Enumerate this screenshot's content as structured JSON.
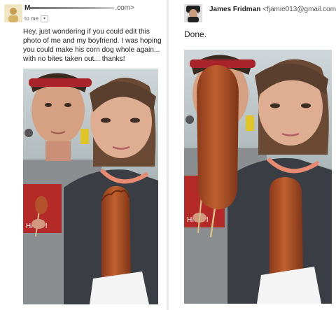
{
  "left_email": {
    "sender_name_visible": "M",
    "sender_email_suffix": ".com>",
    "to_label": "to me",
    "to_caret": "▾",
    "message": "Hey, just wondering if you could edit this\nphoto of me and my boyfriend. I was hoping\nyou could make his corn dog whole again...\nwith no bites taken out... thanks!"
  },
  "right_email": {
    "sender_name": "James Fridman",
    "sender_email": "<fjamie013@gmail.com>",
    "reply_text": "Done."
  },
  "colors": {
    "corn_dog": "#b4522b",
    "shirt_red": "#b32a29",
    "hair": "#3a2a1f",
    "skin": "#d79f84"
  },
  "icons": {
    "left_avatar": "user-avatar-icon",
    "right_avatar": "user-avatar-icon"
  }
}
